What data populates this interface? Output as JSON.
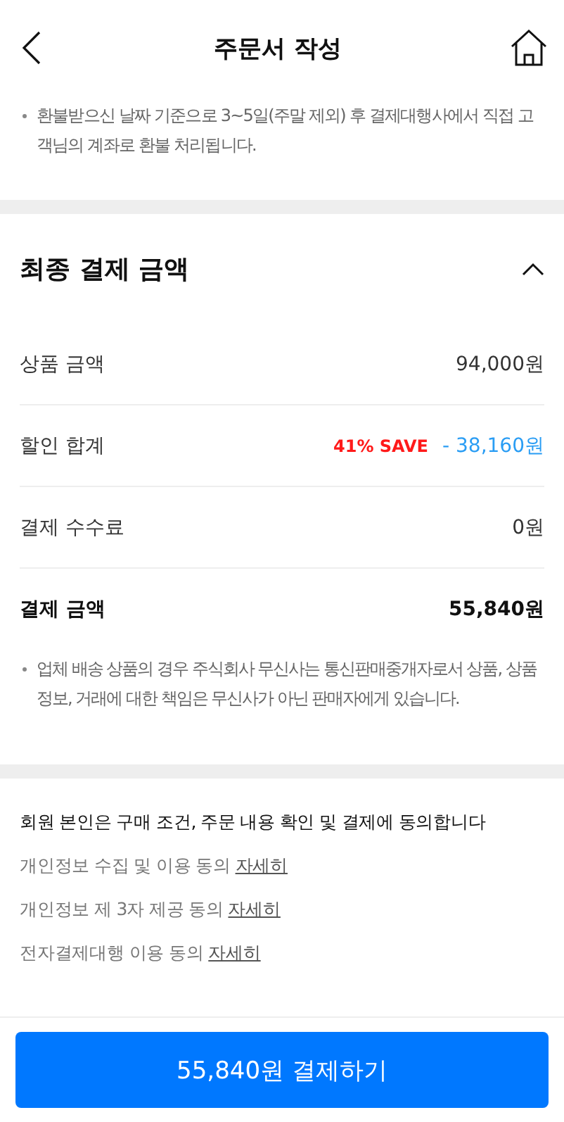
{
  "header": {
    "title": "주문서 작성"
  },
  "refund_note": "환불받으신 날짜 기준으로 3~5일(주말 제외) 후 결제대행사에서 직접 고객님의 계좌로 환불 처리됩니다.",
  "summary": {
    "title": "최종 결제 금액",
    "expanded": true,
    "rows": [
      {
        "kind": "plain",
        "label": "상품 금액",
        "value": "94,000원"
      },
      {
        "kind": "discount",
        "label": "할인 합계",
        "badge": "41% SAVE",
        "value": "- 38,160원"
      },
      {
        "kind": "plain",
        "label": "결제 수수료",
        "value": "0원"
      },
      {
        "kind": "total",
        "label": "결제 금액",
        "value": "55,840원"
      }
    ],
    "note": "업체 배송 상품의 경우 주식회사 무신사는 통신판매중개자로서 상품, 상품정보, 거래에 대한 책임은 무신사가 아닌 판매자에게 있습니다."
  },
  "agreement": {
    "title": "회원 본인은 구매 조건, 주문 내용 확인 및 결제에 동의합니다",
    "items": [
      {
        "label": "개인정보 수집 및 이용 동의",
        "link": "자세히"
      },
      {
        "label": "개인정보 제 3자 제공 동의",
        "link": "자세히"
      },
      {
        "label": "전자결제대행 이용 동의",
        "link": "자세히"
      }
    ]
  },
  "pay_button": "55,840원 결제하기"
}
